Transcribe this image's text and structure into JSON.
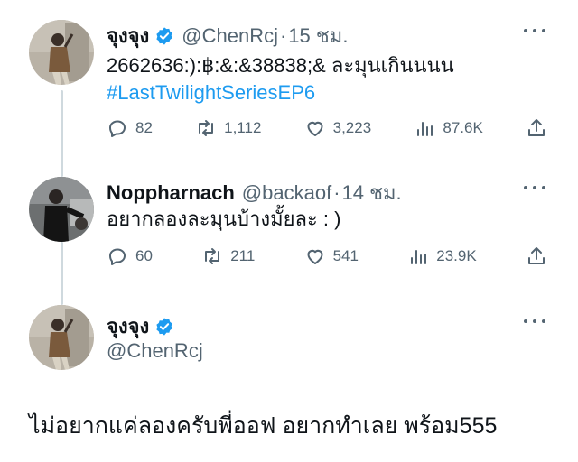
{
  "tweets": [
    {
      "name": "จุงจุง",
      "handle": "@ChenRcj",
      "time": "15 ชม.",
      "text": "2662636:):฿:&:&38838;& ละมุนเกินนนน",
      "hashtag": "#LastTwilightSeriesEP6",
      "replies": "82",
      "retweets": "1,112",
      "likes": "3,223",
      "views": "87.6K"
    },
    {
      "name": "Noppharnach",
      "handle": "@backaof",
      "time": "14 ชม.",
      "text": "อยากลองละมุนบ้างมั้ยละ : )",
      "replies": "60",
      "retweets": "211",
      "likes": "541",
      "views": "23.9K"
    },
    {
      "name": "จุงจุง",
      "handle": "@ChenRcj",
      "text": "ไม่อยากแค่ลองครับพี่ออฟ อยากทำเลย พร้อม555"
    }
  ],
  "separator": "·",
  "icons": {
    "reply": "reply-icon",
    "retweet": "retweet-icon",
    "like": "like-icon",
    "views": "views-icon",
    "share": "share-icon",
    "verified": "verified-badge-icon",
    "more": "more-icon"
  },
  "colors": {
    "accent": "#1d9bf0",
    "secondary_text": "#536471",
    "thread_line": "#cfd9de"
  }
}
